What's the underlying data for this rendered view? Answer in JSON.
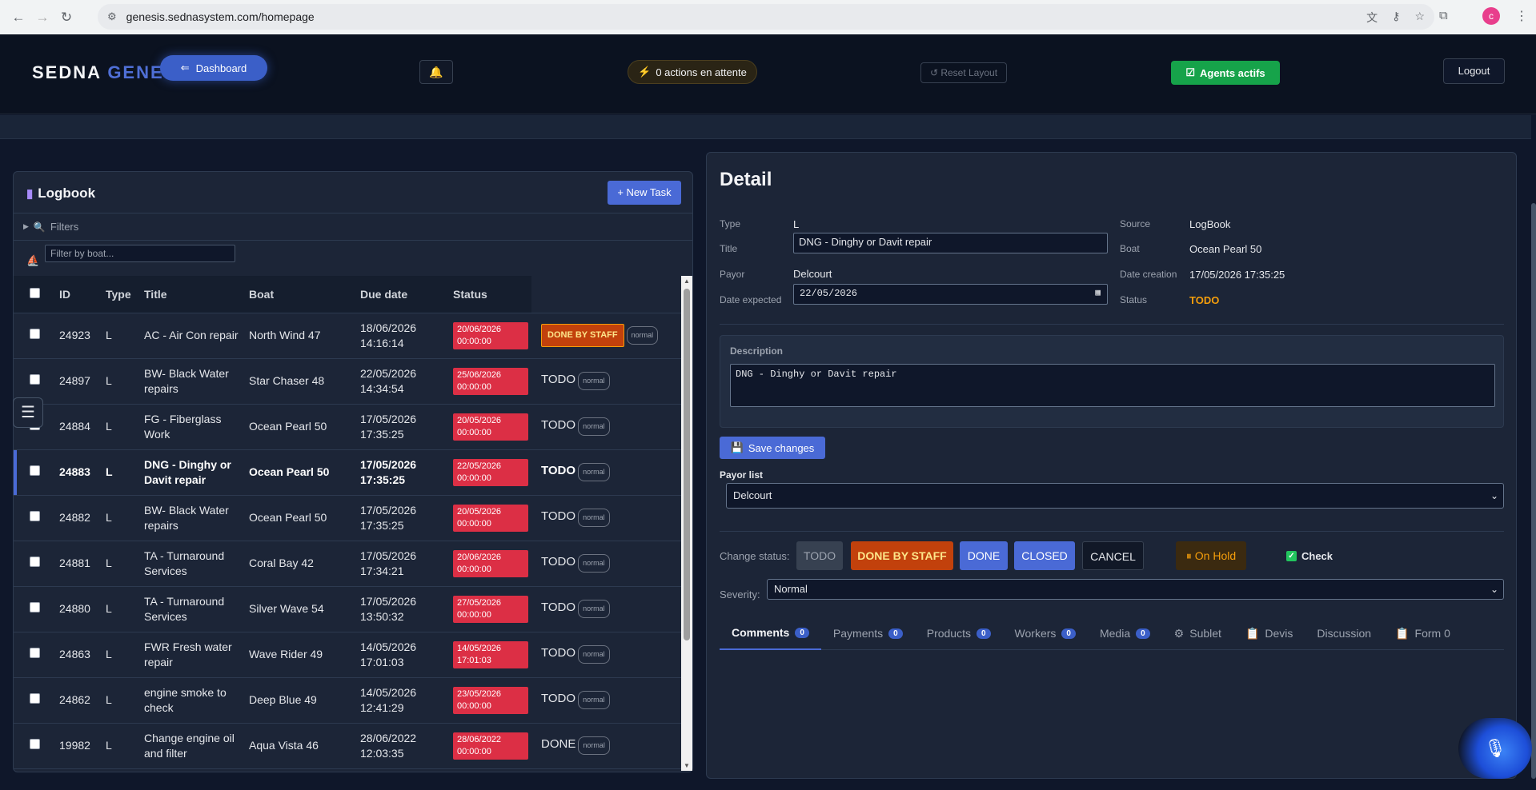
{
  "browser": {
    "url": "genesis.sednasystem.com/homepage",
    "profile_initial": "c"
  },
  "header": {
    "brand_main": "SEDNA ",
    "brand_accent": "GENE",
    "dashboard_label": "Dashboard",
    "pending_label": "0 actions en attente",
    "reset_label": "↺ Reset Layout",
    "agents_label": "Agents actifs",
    "logout_label": "Logout"
  },
  "logbook": {
    "title": "Logbook",
    "new_task_label": "+ New Task",
    "filters_label": "Filters",
    "boat_filter_placeholder": "Filter by boat...",
    "columns": [
      "ID",
      "Type",
      "Title",
      "Boat",
      "Due date",
      "Status"
    ],
    "rows": [
      {
        "id": "24923",
        "type": "L",
        "title": "AC - Air Con repair",
        "boat": "North Wind 47",
        "date": "18/06/2026",
        "time": "14:16:14",
        "due1": "20/06/2026",
        "due2": "00:00:00",
        "status": "DONE BY STAFF",
        "severity": "normal"
      },
      {
        "id": "24897",
        "type": "L",
        "title": "BW- Black Water repairs",
        "boat": "Star Chaser 48",
        "date": "22/05/2026",
        "time": "14:34:54",
        "due1": "25/06/2026",
        "due2": "00:00:00",
        "status": "TODO",
        "severity": "normal"
      },
      {
        "id": "24884",
        "type": "L",
        "title": "FG - Fiberglass Work",
        "boat": "Ocean Pearl 50",
        "date": "17/05/2026",
        "time": "17:35:25",
        "due1": "20/05/2026",
        "due2": "00:00:00",
        "status": "TODO",
        "severity": "normal"
      },
      {
        "id": "24883",
        "type": "L",
        "title": "DNG - Dinghy or Davit repair",
        "boat": "Ocean Pearl 50",
        "date": "17/05/2026",
        "time": "17:35:25",
        "due1": "22/05/2026",
        "due2": "00:00:00",
        "status": "TODO",
        "severity": "normal"
      },
      {
        "id": "24882",
        "type": "L",
        "title": "BW- Black Water repairs",
        "boat": "Ocean Pearl 50",
        "date": "17/05/2026",
        "time": "17:35:25",
        "due1": "20/05/2026",
        "due2": "00:00:00",
        "status": "TODO",
        "severity": "normal"
      },
      {
        "id": "24881",
        "type": "L",
        "title": "TA - Turnaround Services",
        "boat": "Coral Bay 42",
        "date": "17/05/2026",
        "time": "17:34:21",
        "due1": "20/06/2026",
        "due2": "00:00:00",
        "status": "TODO",
        "severity": "normal"
      },
      {
        "id": "24880",
        "type": "L",
        "title": "TA - Turnaround Services",
        "boat": "Silver Wave 54",
        "date": "17/05/2026",
        "time": "13:50:32",
        "due1": "27/05/2026",
        "due2": "00:00:00",
        "status": "TODO",
        "severity": "normal"
      },
      {
        "id": "24863",
        "type": "L",
        "title": "FWR Fresh water repair",
        "boat": "Wave Rider 49",
        "date": "14/05/2026",
        "time": "17:01:03",
        "due1": "14/05/2026",
        "due2": "17:01:03",
        "status": "TODO",
        "severity": "normal"
      },
      {
        "id": "24862",
        "type": "L",
        "title": "engine smoke to check",
        "boat": "Deep Blue 49",
        "date": "14/05/2026",
        "time": "12:41:29",
        "due1": "23/05/2026",
        "due2": "00:00:00",
        "status": "TODO",
        "severity": "normal"
      },
      {
        "id": "19982",
        "type": "L",
        "title": "Change engine oil and filter",
        "boat": "Aqua Vista 46",
        "date": "28/06/2022",
        "time": "12:03:35",
        "due1": "28/06/2022",
        "due2": "00:00:00",
        "status": "DONE",
        "severity": "normal"
      }
    ]
  },
  "detail": {
    "title": "Detail",
    "type_label": "Type",
    "type_value": "L",
    "title_label": "Title",
    "title_value": "DNG - Dinghy or Davit repair",
    "payor_label": "Payor",
    "payor_value": "Delcourt",
    "date_expected_label": "Date expected",
    "date_expected_value": "22/05/2026",
    "source_label": "Source",
    "source_value": "LogBook",
    "boat_label": "Boat",
    "boat_value": "Ocean Pearl 50",
    "date_creation_label": "Date creation",
    "date_creation_value": "17/05/2026 17:35:25",
    "status_label": "Status",
    "status_value": "TODO",
    "description_label": "Description",
    "description_value": "DNG - Dinghy or Davit repair",
    "save_label": "Save changes",
    "payor_list_label": "Payor list",
    "payor_list_value": "Delcourt",
    "change_status_label": "Change status:",
    "status_buttons": {
      "todo": "TODO",
      "done_by_staff": "DONE BY STAFF",
      "done": "DONE",
      "closed": "CLOSED",
      "cancel": "CANCEL",
      "on_hold": "On Hold"
    },
    "check_label": "Check",
    "severity_label": "Severity:",
    "severity_value": "Normal",
    "tabs": [
      {
        "label": "Comments",
        "count": "0"
      },
      {
        "label": "Payments",
        "count": "0"
      },
      {
        "label": "Products",
        "count": "0"
      },
      {
        "label": "Workers",
        "count": "0"
      },
      {
        "label": "Media",
        "count": "0"
      },
      {
        "label": "Sublet"
      },
      {
        "label": "Devis"
      },
      {
        "label": "Discussion"
      },
      {
        "label": "Form 0"
      }
    ]
  },
  "colors": {
    "accent": "#4a6ad6",
    "due_badge": "#dc2f45",
    "done_by_staff": "#c2410c",
    "agents": "#16a34a",
    "todo": "#f59e0b"
  }
}
